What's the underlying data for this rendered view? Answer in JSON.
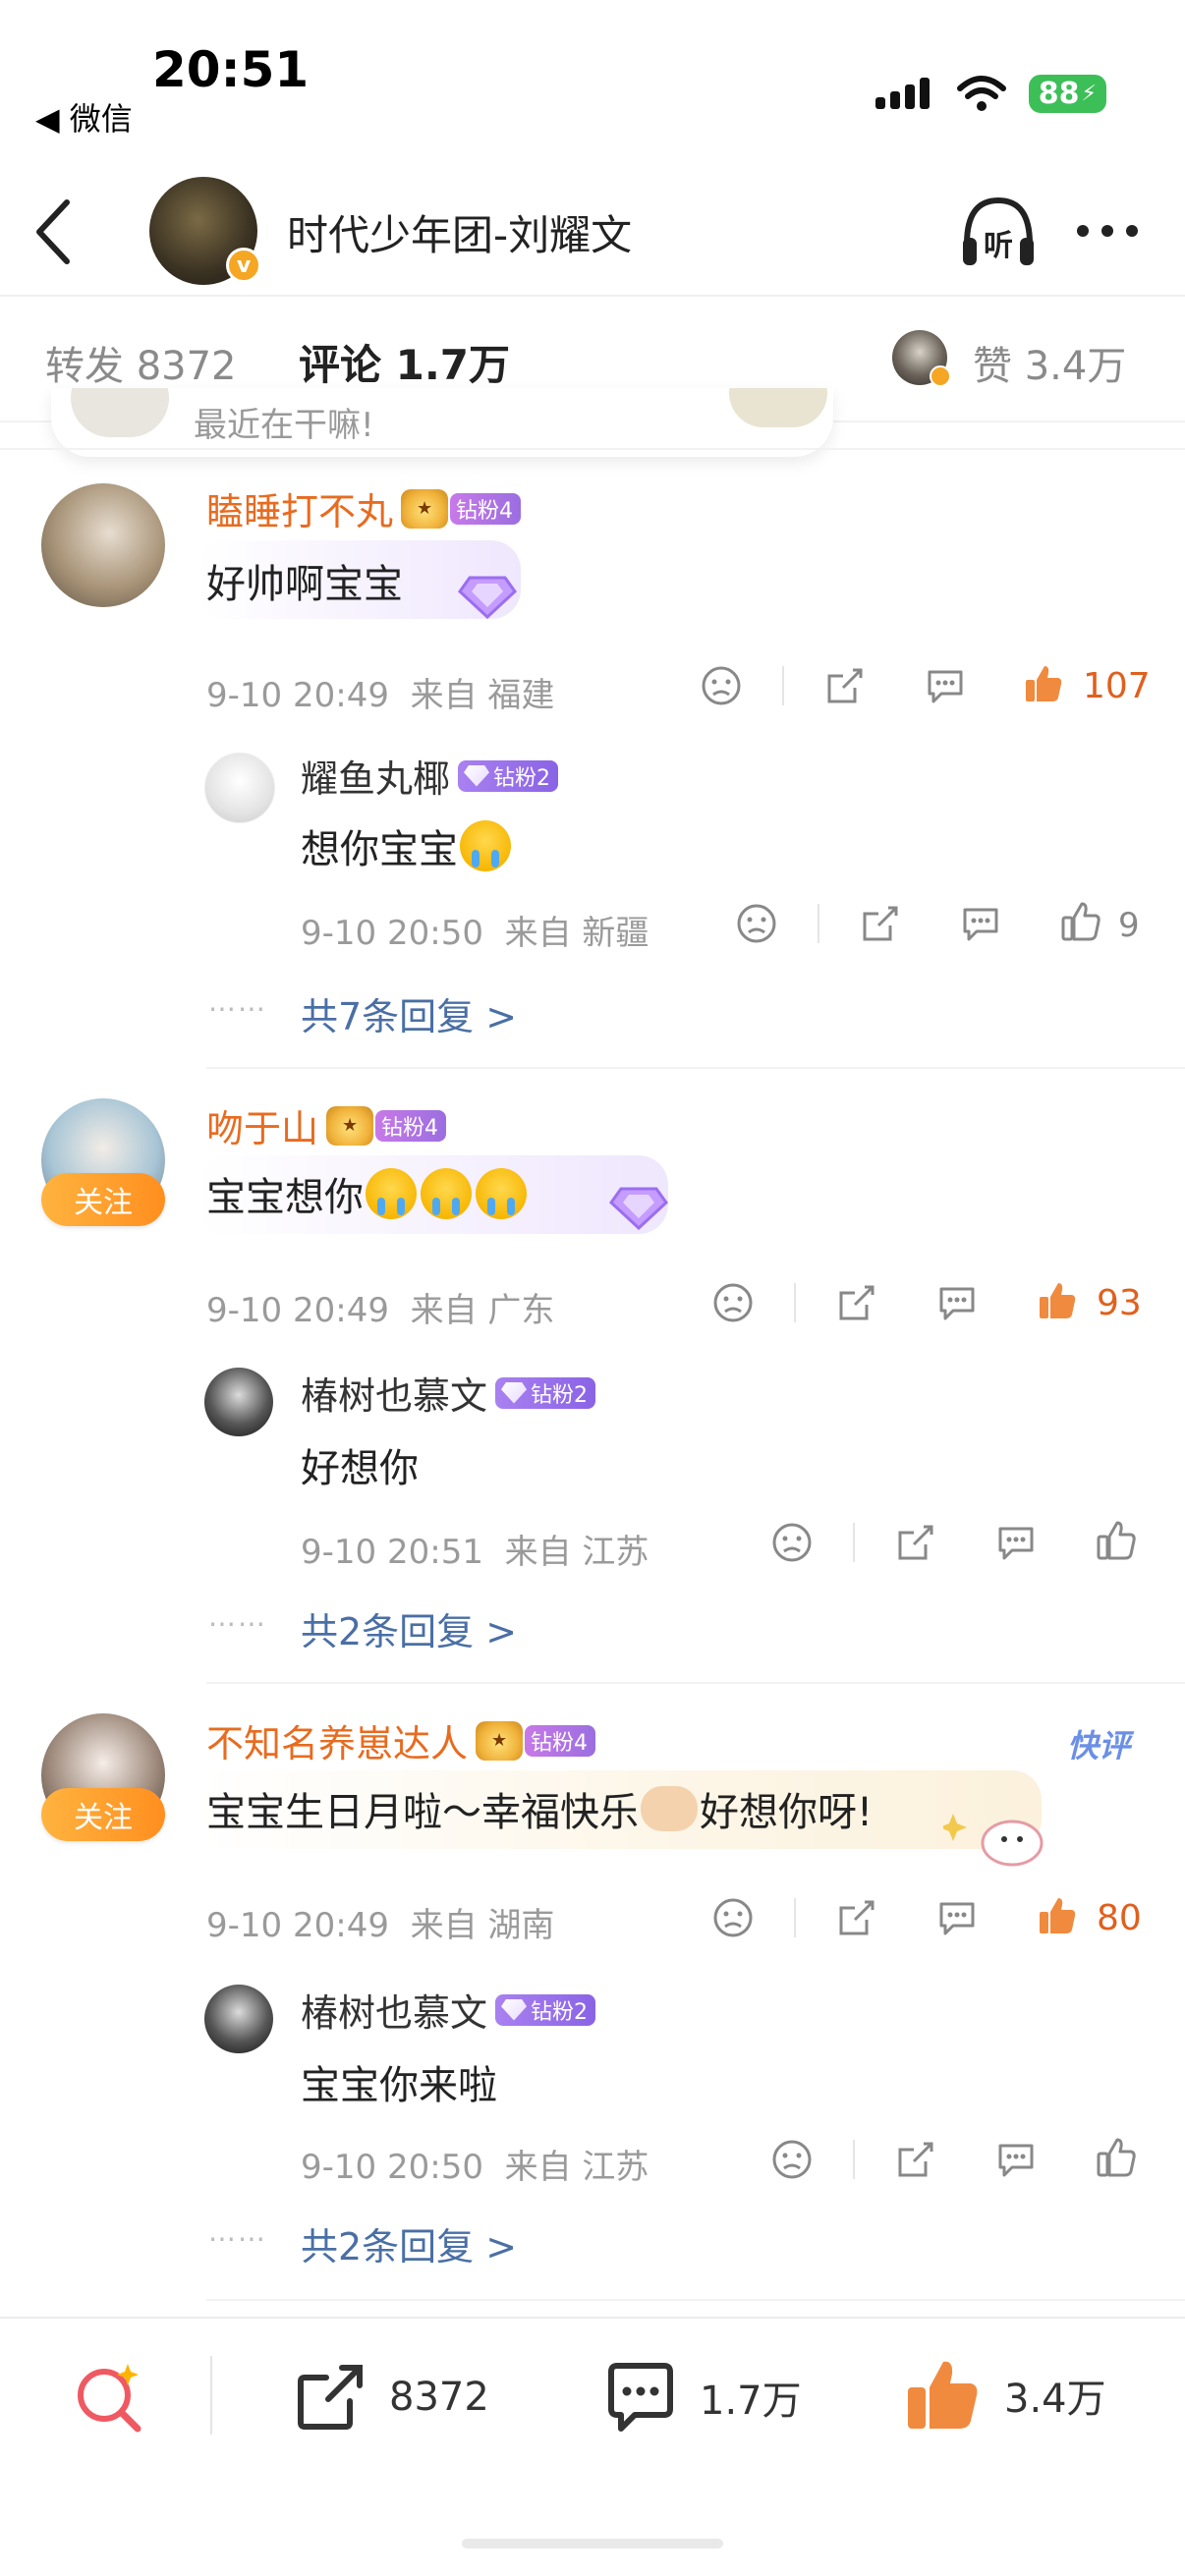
{
  "status_bar": {
    "time": "20:51",
    "back_app": "◀ 微信",
    "battery": "88"
  },
  "header": {
    "title": "时代少年团-刘耀文",
    "avatar_badge": "v"
  },
  "tabs": {
    "repost": "转发 8372",
    "comment": "评论 1.7万",
    "likes": "赞 3.4万"
  },
  "pinned_preview": {
    "text": "最近在干嘛!"
  },
  "comments": [
    {
      "user": "瞌睡打不丸",
      "badge": "钻粉4",
      "text": "好帅啊宝宝",
      "time": "9-10 20:49",
      "location": "来自 福建",
      "likes": "107",
      "reply": {
        "user": "耀鱼丸椰",
        "badge": "钻粉2",
        "text": "想你宝宝",
        "time": "9-10 20:50",
        "location": "来自 新疆",
        "likes": "9"
      },
      "more": "共7条回复 >"
    },
    {
      "user": "吻于山",
      "badge": "钻粉4",
      "text": "宝宝想你",
      "follow": "关注",
      "time": "9-10 20:49",
      "location": "来自 广东",
      "likes": "93",
      "reply": {
        "user": "椿树也慕文",
        "badge": "钻粉2",
        "text": "好想你",
        "time": "9-10 20:51",
        "location": "来自 江苏",
        "likes": ""
      },
      "more": "共2条回复 >"
    },
    {
      "user": "不知名养崽达人",
      "badge": "钻粉4",
      "text_a": "宝宝生日月啦～幸福快乐",
      "text_b": "好想你呀!",
      "follow": "关注",
      "tag": "快评",
      "time": "9-10 20:49",
      "location": "来自 湖南",
      "likes": "80",
      "reply": {
        "user": "椿树也慕文",
        "badge": "钻粉2",
        "text": "宝宝你来啦",
        "time": "9-10 20:50",
        "location": "来自 江苏",
        "likes": ""
      },
      "more": "共2条回复 >"
    }
  ],
  "bottom_bar": {
    "repost": "8372",
    "comment": "1.7万",
    "like": "3.4万"
  },
  "colors": {
    "accent": "#ff8200",
    "username": "#e86b1f",
    "link": "#4a6fa5",
    "badge": "#9b6ee0"
  }
}
